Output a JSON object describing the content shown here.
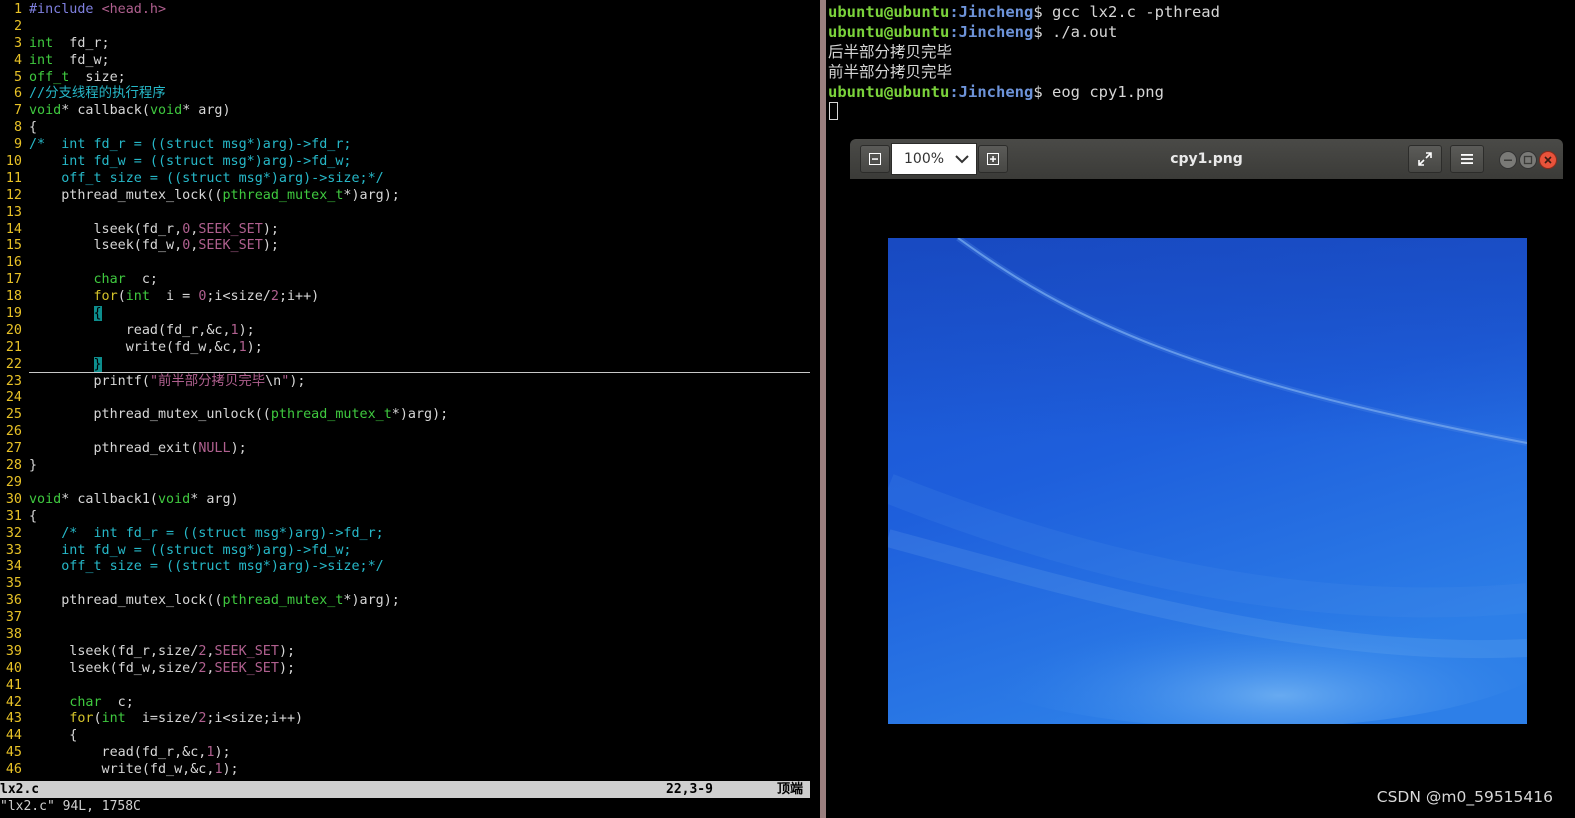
{
  "vim": {
    "lines": [
      {
        "n": "1",
        "segs": [
          [
            "pre",
            "#include "
          ],
          [
            "inc",
            "<head.h>"
          ]
        ]
      },
      {
        "n": "2",
        "segs": []
      },
      {
        "n": "3",
        "segs": [
          [
            "type",
            "int"
          ],
          [
            "",
            "  fd_r;"
          ]
        ]
      },
      {
        "n": "4",
        "segs": [
          [
            "type",
            "int"
          ],
          [
            "",
            "  fd_w;"
          ]
        ]
      },
      {
        "n": "5",
        "segs": [
          [
            "type",
            "off_t"
          ],
          [
            "",
            "  size;"
          ]
        ]
      },
      {
        "n": "6",
        "segs": [
          [
            "cmt",
            "//分支线程的执行程序"
          ]
        ]
      },
      {
        "n": "7",
        "segs": [
          [
            "type",
            "void"
          ],
          [
            "",
            "* callback("
          ],
          [
            "type",
            "void"
          ],
          [
            "",
            "* arg)"
          ]
        ]
      },
      {
        "n": "8",
        "segs": [
          [
            "",
            "{"
          ]
        ]
      },
      {
        "n": "9",
        "segs": [
          [
            "cmt",
            "/*  int fd_r = ((struct msg*)arg)->fd_r;"
          ]
        ]
      },
      {
        "n": "10",
        "segs": [
          [
            "cmt",
            "    int fd_w = ((struct msg*)arg)->fd_w;"
          ]
        ]
      },
      {
        "n": "11",
        "segs": [
          [
            "cmt",
            "    off_t size = ((struct msg*)arg)->size;*/"
          ]
        ]
      },
      {
        "n": "12",
        "segs": [
          [
            "",
            "    pthread_mutex_lock(("
          ],
          [
            "type",
            "pthread_mutex_t"
          ],
          [
            "",
            "*)arg);"
          ]
        ]
      },
      {
        "n": "13",
        "segs": []
      },
      {
        "n": "14",
        "segs": [
          [
            "",
            "        lseek(fd_r,"
          ],
          [
            "num",
            "0"
          ],
          [
            "",
            ","
          ],
          [
            "num",
            "SEEK_SET"
          ],
          [
            "",
            ");"
          ]
        ]
      },
      {
        "n": "15",
        "segs": [
          [
            "",
            "        lseek(fd_w,"
          ],
          [
            "num",
            "0"
          ],
          [
            "",
            ","
          ],
          [
            "num",
            "SEEK_SET"
          ],
          [
            "",
            ");"
          ]
        ]
      },
      {
        "n": "16",
        "segs": []
      },
      {
        "n": "17",
        "segs": [
          [
            "",
            "        "
          ],
          [
            "type",
            "char"
          ],
          [
            "",
            "  c;"
          ]
        ]
      },
      {
        "n": "18",
        "segs": [
          [
            "",
            "        "
          ],
          [
            "kw",
            "for"
          ],
          [
            "",
            "("
          ],
          [
            "type",
            "int"
          ],
          [
            "",
            "  i = "
          ],
          [
            "num",
            "0"
          ],
          [
            "",
            ";i<size/"
          ],
          [
            "num",
            "2"
          ],
          [
            "",
            ";i++)"
          ]
        ]
      },
      {
        "n": "19",
        "segs": [
          [
            "",
            "        "
          ],
          [
            "cur",
            "{"
          ]
        ]
      },
      {
        "n": "20",
        "segs": [
          [
            "",
            "            read(fd_r,&c,"
          ],
          [
            "num",
            "1"
          ],
          [
            "",
            ");"
          ]
        ]
      },
      {
        "n": "21",
        "segs": [
          [
            "",
            "            write(fd_w,&c,"
          ],
          [
            "num",
            "1"
          ],
          [
            "",
            ");"
          ]
        ]
      },
      {
        "n": "22",
        "segs": [
          [
            "",
            "        "
          ],
          [
            "cur",
            "}"
          ]
        ]
      },
      {
        "n": "23",
        "segs": [
          [
            "",
            "        printf("
          ],
          [
            "str",
            "\"前半部分拷贝完毕"
          ],
          [
            "bold",
            "\\n"
          ],
          [
            "str",
            "\""
          ],
          [
            "",
            ");"
          ]
        ]
      },
      {
        "n": "24",
        "segs": []
      },
      {
        "n": "25",
        "segs": [
          [
            "",
            "        pthread_mutex_unlock(("
          ],
          [
            "type",
            "pthread_mutex_t"
          ],
          [
            "",
            "*)arg);"
          ]
        ]
      },
      {
        "n": "26",
        "segs": []
      },
      {
        "n": "27",
        "segs": [
          [
            "",
            "        pthread_exit("
          ],
          [
            "num",
            "NULL"
          ],
          [
            "",
            ");"
          ]
        ]
      },
      {
        "n": "28",
        "segs": [
          [
            "",
            "}"
          ]
        ]
      },
      {
        "n": "29",
        "segs": []
      },
      {
        "n": "30",
        "segs": [
          [
            "type",
            "void"
          ],
          [
            "",
            "* callback1("
          ],
          [
            "type",
            "void"
          ],
          [
            "",
            "* arg)"
          ]
        ]
      },
      {
        "n": "31",
        "segs": [
          [
            "",
            "{"
          ]
        ]
      },
      {
        "n": "32",
        "segs": [
          [
            "cmt",
            "    /*  int fd_r = ((struct msg*)arg)->fd_r;"
          ]
        ]
      },
      {
        "n": "33",
        "segs": [
          [
            "cmt",
            "    int fd_w = ((struct msg*)arg)->fd_w;"
          ]
        ]
      },
      {
        "n": "34",
        "segs": [
          [
            "cmt",
            "    off_t size = ((struct msg*)arg)->size;*/"
          ]
        ]
      },
      {
        "n": "35",
        "segs": []
      },
      {
        "n": "36",
        "segs": [
          [
            "",
            "    pthread_mutex_lock(("
          ],
          [
            "type",
            "pthread_mutex_t"
          ],
          [
            "",
            "*)arg);"
          ]
        ]
      },
      {
        "n": "37",
        "segs": []
      },
      {
        "n": "38",
        "segs": []
      },
      {
        "n": "39",
        "segs": [
          [
            "",
            "     lseek(fd_r,size/"
          ],
          [
            "num",
            "2"
          ],
          [
            "",
            ","
          ],
          [
            "num",
            "SEEK_SET"
          ],
          [
            "",
            ");"
          ]
        ]
      },
      {
        "n": "40",
        "segs": [
          [
            "",
            "     lseek(fd_w,size/"
          ],
          [
            "num",
            "2"
          ],
          [
            "",
            ","
          ],
          [
            "num",
            "SEEK_SET"
          ],
          [
            "",
            ");"
          ]
        ]
      },
      {
        "n": "41",
        "segs": []
      },
      {
        "n": "42",
        "segs": [
          [
            "",
            "     "
          ],
          [
            "type",
            "char"
          ],
          [
            "",
            "  c;"
          ]
        ]
      },
      {
        "n": "43",
        "segs": [
          [
            "",
            "     "
          ],
          [
            "kw",
            "for"
          ],
          [
            "",
            "("
          ],
          [
            "type",
            "int"
          ],
          [
            "",
            "  i=size/"
          ],
          [
            "num",
            "2"
          ],
          [
            "",
            ";i<size;i++)"
          ]
        ]
      },
      {
        "n": "44",
        "segs": [
          [
            "",
            "     {"
          ]
        ]
      },
      {
        "n": "45",
        "segs": [
          [
            "",
            "         read(fd_r,&c,"
          ],
          [
            "num",
            "1"
          ],
          [
            "",
            ");"
          ]
        ]
      },
      {
        "n": "46",
        "segs": [
          [
            "",
            "         write(fd_w,&c,"
          ],
          [
            "num",
            "1"
          ],
          [
            "",
            ");"
          ]
        ]
      }
    ],
    "status_file": "lx2.c",
    "status_pos": "22,3-9",
    "status_scroll": "顶端",
    "cmdline": "\"lx2.c\" 94L, 1758C"
  },
  "terminal": {
    "lines": [
      {
        "user": "ubuntu@ubuntu",
        "path": ":Jincheng",
        "cmd": "$ gcc lx2.c -pthread"
      },
      {
        "user": "ubuntu@ubuntu",
        "path": ":Jincheng",
        "cmd": "$ ./a.out"
      },
      {
        "out": "后半部分拷贝完毕"
      },
      {
        "out": "前半部分拷贝完毕"
      },
      {
        "user": "ubuntu@ubuntu",
        "path": ":Jincheng",
        "cmd": "$ eog cpy1.png"
      }
    ]
  },
  "eog": {
    "title": "cpy1.png",
    "zoom": "100%",
    "icons": [
      "zoom-out-icon",
      "zoom-in-icon",
      "fullscreen-icon",
      "menu-icon",
      "minimize-icon",
      "maximize-icon",
      "close-icon"
    ]
  },
  "watermark": "CSDN @m0_59515416",
  "colors": {
    "line_numbers": "#e8c227",
    "comment": "#26b8c8",
    "type": "#3fc93f",
    "constant": "#b0608f",
    "prompt_user": "#7bd33b",
    "prompt_path": "#6d93d9",
    "divider": "#9a7f7f",
    "close_button": "#e8533b"
  }
}
